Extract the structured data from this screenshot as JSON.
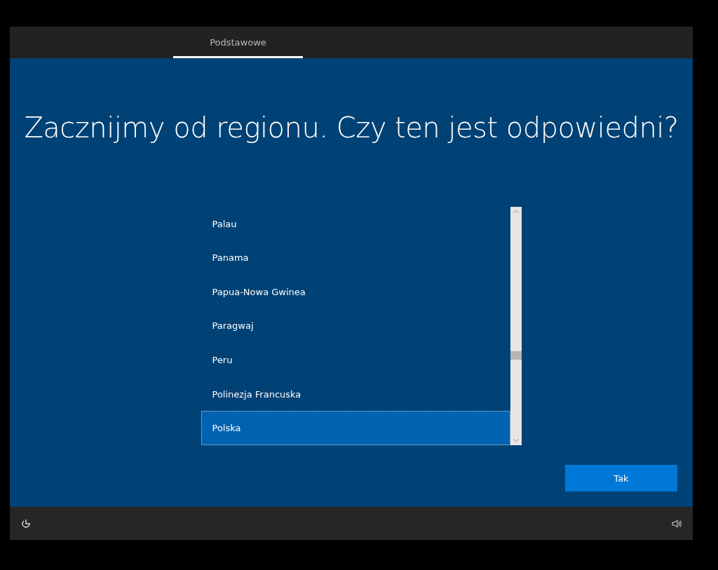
{
  "tabs": [
    {
      "label": "Podstawowe",
      "selected": true
    }
  ],
  "heading": "Zacznijmy od regionu. Czy ten jest odpowiedni?",
  "regions": [
    {
      "label": "Palau",
      "selected": false
    },
    {
      "label": "Panama",
      "selected": false
    },
    {
      "label": "Papua-Nowa Gwinea",
      "selected": false
    },
    {
      "label": "Paragwaj",
      "selected": false
    },
    {
      "label": "Peru",
      "selected": false
    },
    {
      "label": "Polinezja Francuska",
      "selected": false
    },
    {
      "label": "Polska",
      "selected": true
    }
  ],
  "confirm_button": "Tak"
}
